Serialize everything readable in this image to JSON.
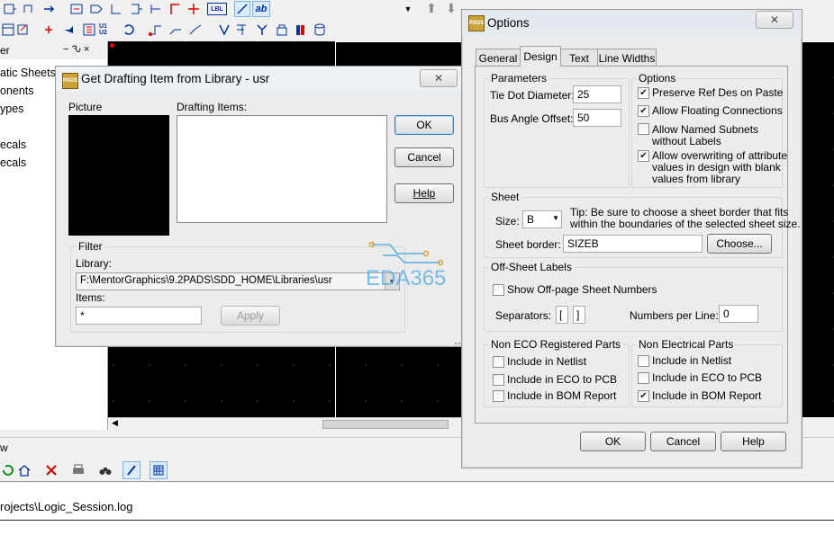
{
  "app": {
    "left_panel_items": [
      "atic Sheets",
      "onents",
      "ypes",
      "ecals",
      "ecals"
    ],
    "panel_partial_title": "er",
    "panel_pin": "− Ԅ ×",
    "bottom_label": "w",
    "log_path": "rojects\\Logic_Session.log",
    "toolbar_text_btn": "LBL",
    "toolbar_ab": "ab",
    "toolbar_u12": "U1 U2"
  },
  "drafting_dialog": {
    "title": "Get Drafting Item from Library - usr",
    "picture_label": "Picture",
    "drafting_items_label": "Drafting Items:",
    "ok": "OK",
    "cancel": "Cancel",
    "help": "Help",
    "filter_label": "Filter",
    "library_label": "Library:",
    "library_value": "F:\\MentorGraphics\\9.2PADS\\SDD_HOME\\Libraries\\usr",
    "items_label": "Items:",
    "items_value": "*",
    "apply": "Apply",
    "watermark": "EDA365"
  },
  "options_dialog": {
    "title": "Options",
    "tabs": [
      "General",
      "Design",
      "Text",
      "Line Widths"
    ],
    "active_tab": "Design",
    "parameters": {
      "label": "Parameters",
      "tie_dot_label": "Tie Dot Diameter:",
      "tie_dot_value": "25",
      "bus_angle_label": "Bus Angle Offset:",
      "bus_angle_value": "50"
    },
    "options": {
      "label": "Options",
      "preserve_ref": "Preserve Ref Des on Paste",
      "allow_floating": "Allow Floating Connections",
      "allow_named_1": "Allow Named Subnets",
      "allow_named_2": "without Labels",
      "allow_overwrite_1": "Allow overwriting of attribute",
      "allow_overwrite_2": "values in design with blank",
      "allow_overwrite_3": "values from library"
    },
    "sheet": {
      "label": "Sheet",
      "size_label": "Size:",
      "size_value": "B",
      "tip_1": "Tip: Be sure to choose a sheet border that fits",
      "tip_2": "within the boundaries of the selected sheet size.",
      "border_label": "Sheet border:",
      "border_value": "SIZEB",
      "choose": "Choose..."
    },
    "off_sheet": {
      "label": "Off-Sheet Labels",
      "show_off_page": "Show Off-page Sheet Numbers",
      "separators_label": "Separators:",
      "sep_left": "[",
      "sep_right": "]",
      "numbers_per_line_label": "Numbers per Line:",
      "numbers_per_line_value": "0"
    },
    "non_eco": {
      "label": "Non ECO Registered Parts",
      "netlist": "Include in Netlist",
      "eco": "Include in ECO to PCB",
      "bom": "Include in BOM Report"
    },
    "non_elec": {
      "label": "Non Electrical Parts",
      "netlist": "Include in Netlist",
      "eco": "Include in ECO to PCB",
      "bom": "Include in BOM Report"
    },
    "ok": "OK",
    "cancel": "Cancel",
    "help": "Help"
  }
}
